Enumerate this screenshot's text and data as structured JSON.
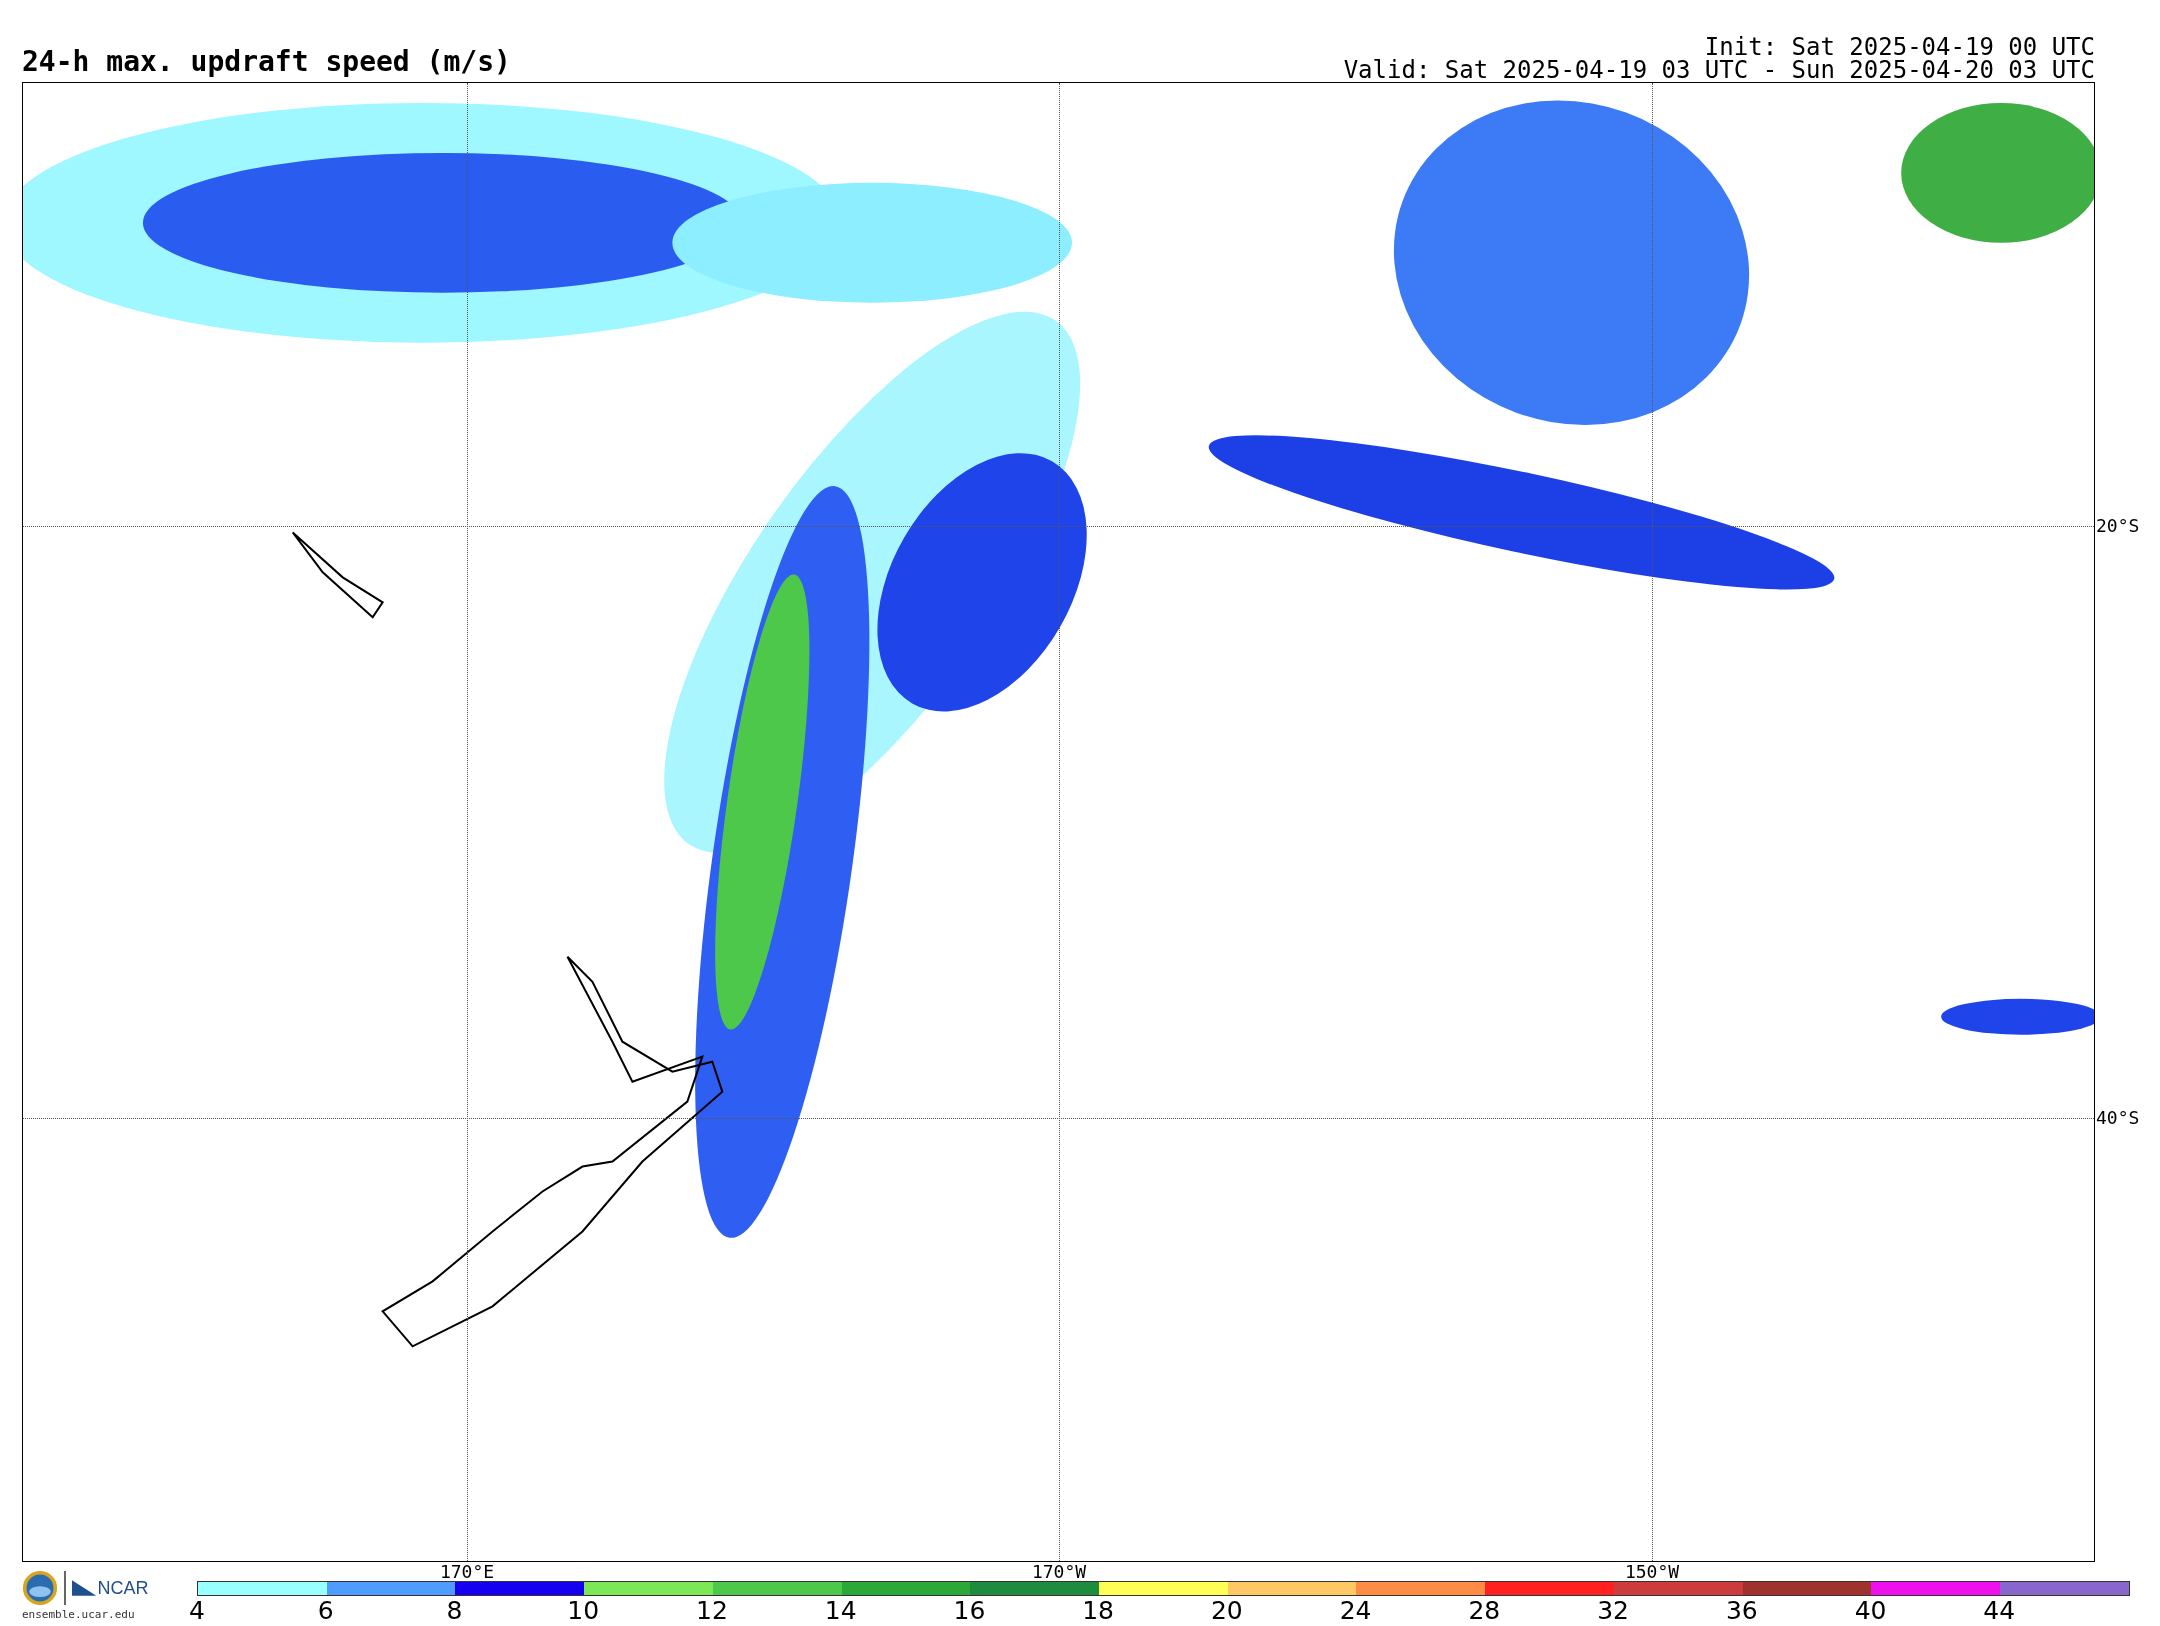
{
  "title": "24-h max. updraft speed (m/s)",
  "init": "Init: Sat 2025-04-19 00 UTC",
  "valid": "Valid: Sat 2025-04-19 03 UTC - Sun 2025-04-20 03 UTC",
  "map": {
    "latitude_labels": [
      "20°S",
      "40°S"
    ],
    "longitude_labels": [
      "170°E",
      "170°W",
      "150°W"
    ]
  },
  "logos": {
    "org": "NCAR",
    "site": "ensemble.ucar.edu"
  },
  "colorbar": {
    "bins": [
      {
        "color": "#99ffff"
      },
      {
        "color": "#4f9bff"
      },
      {
        "color": "#1400ef"
      },
      {
        "color": "#7de857"
      },
      {
        "color": "#4ec84a"
      },
      {
        "color": "#2ca838"
      },
      {
        "color": "#1e8b3e"
      },
      {
        "color": "#ffff55"
      },
      {
        "color": "#ffc864"
      },
      {
        "color": "#ff8c46"
      },
      {
        "color": "#ff2020"
      },
      {
        "color": "#cc3c3c"
      },
      {
        "color": "#a0322d"
      },
      {
        "color": "#ee11ee"
      },
      {
        "color": "#8866cc"
      }
    ],
    "ticks": [
      "4",
      "6",
      "8",
      "10",
      "12",
      "14",
      "16",
      "18",
      "20",
      "24",
      "28",
      "32",
      "36",
      "40",
      "44"
    ]
  }
}
